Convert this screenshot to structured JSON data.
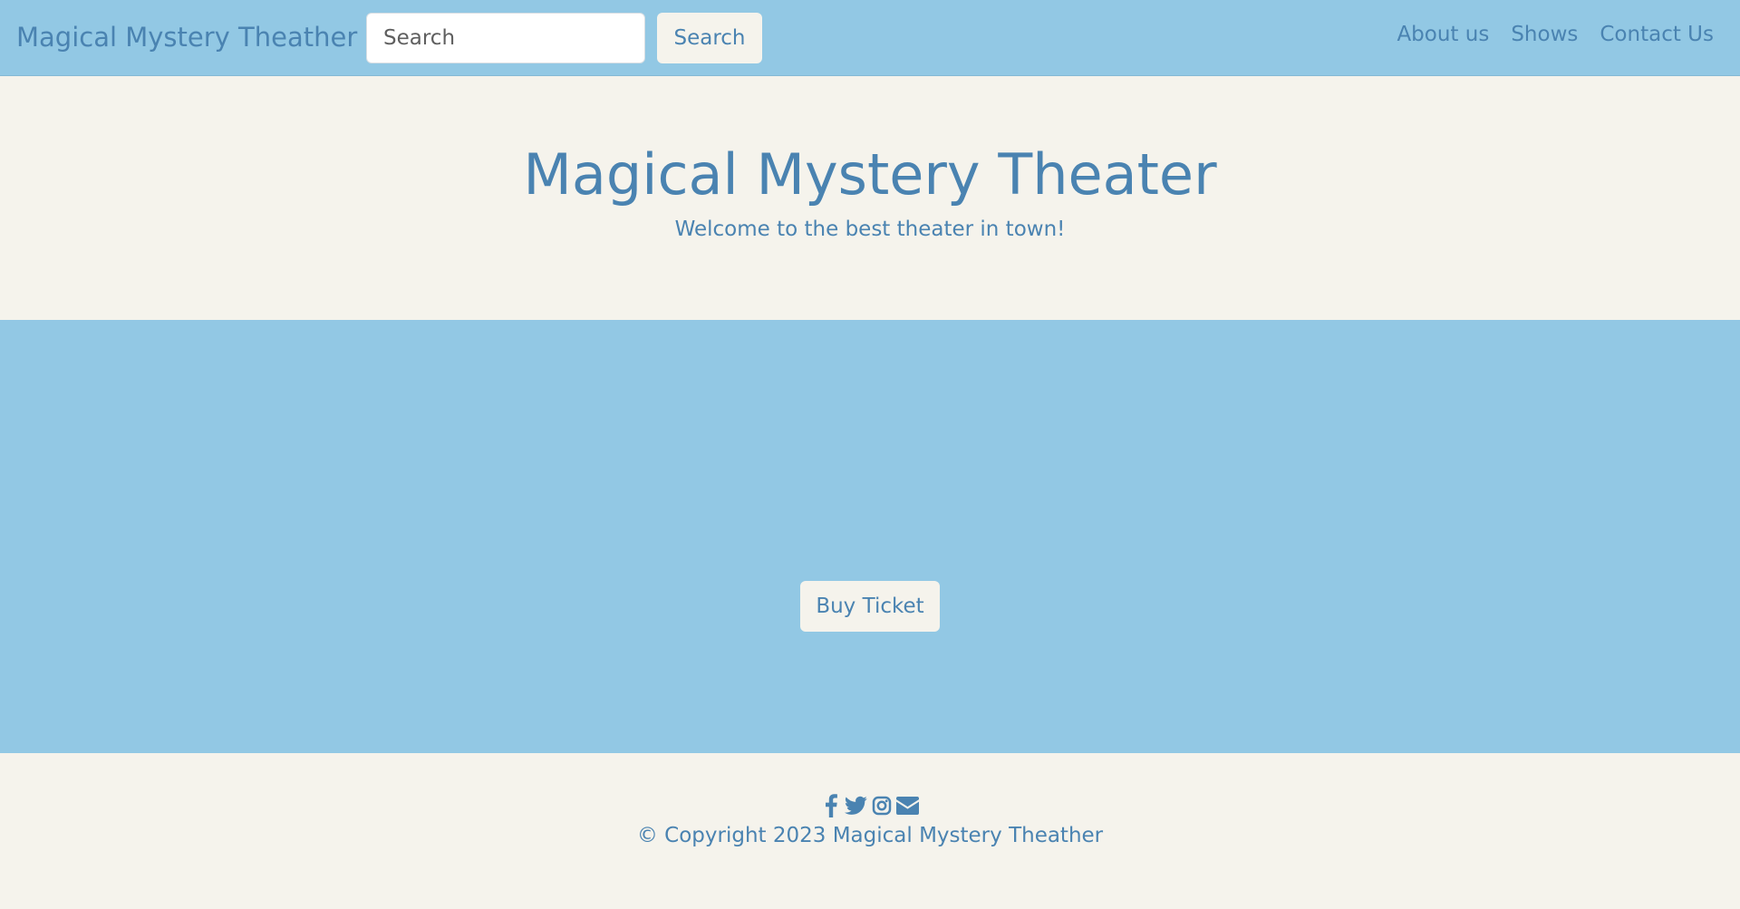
{
  "navbar": {
    "brand": "Magical Mystery Theather",
    "search": {
      "placeholder": "Search",
      "value": ""
    },
    "search_button_label": "Search",
    "links": [
      {
        "label": "About us"
      },
      {
        "label": "Shows"
      },
      {
        "label": "Contact Us"
      }
    ]
  },
  "hero": {
    "title": "Magical Mystery Theater",
    "subtitle": "Welcome to the best theater in town!"
  },
  "showcase": {
    "buy_button_label": "Buy Ticket"
  },
  "footer": {
    "social_icons": [
      "facebook-icon",
      "twitter-icon",
      "instagram-icon",
      "envelope-icon"
    ],
    "copyright": "© Copyright 2023 Magical Mystery Theather"
  },
  "colors": {
    "navbar_background": "#92c8e4",
    "page_background": "#f5f3ec",
    "text_accent": "#4a83b1",
    "button_background": "#f5f3ec"
  }
}
